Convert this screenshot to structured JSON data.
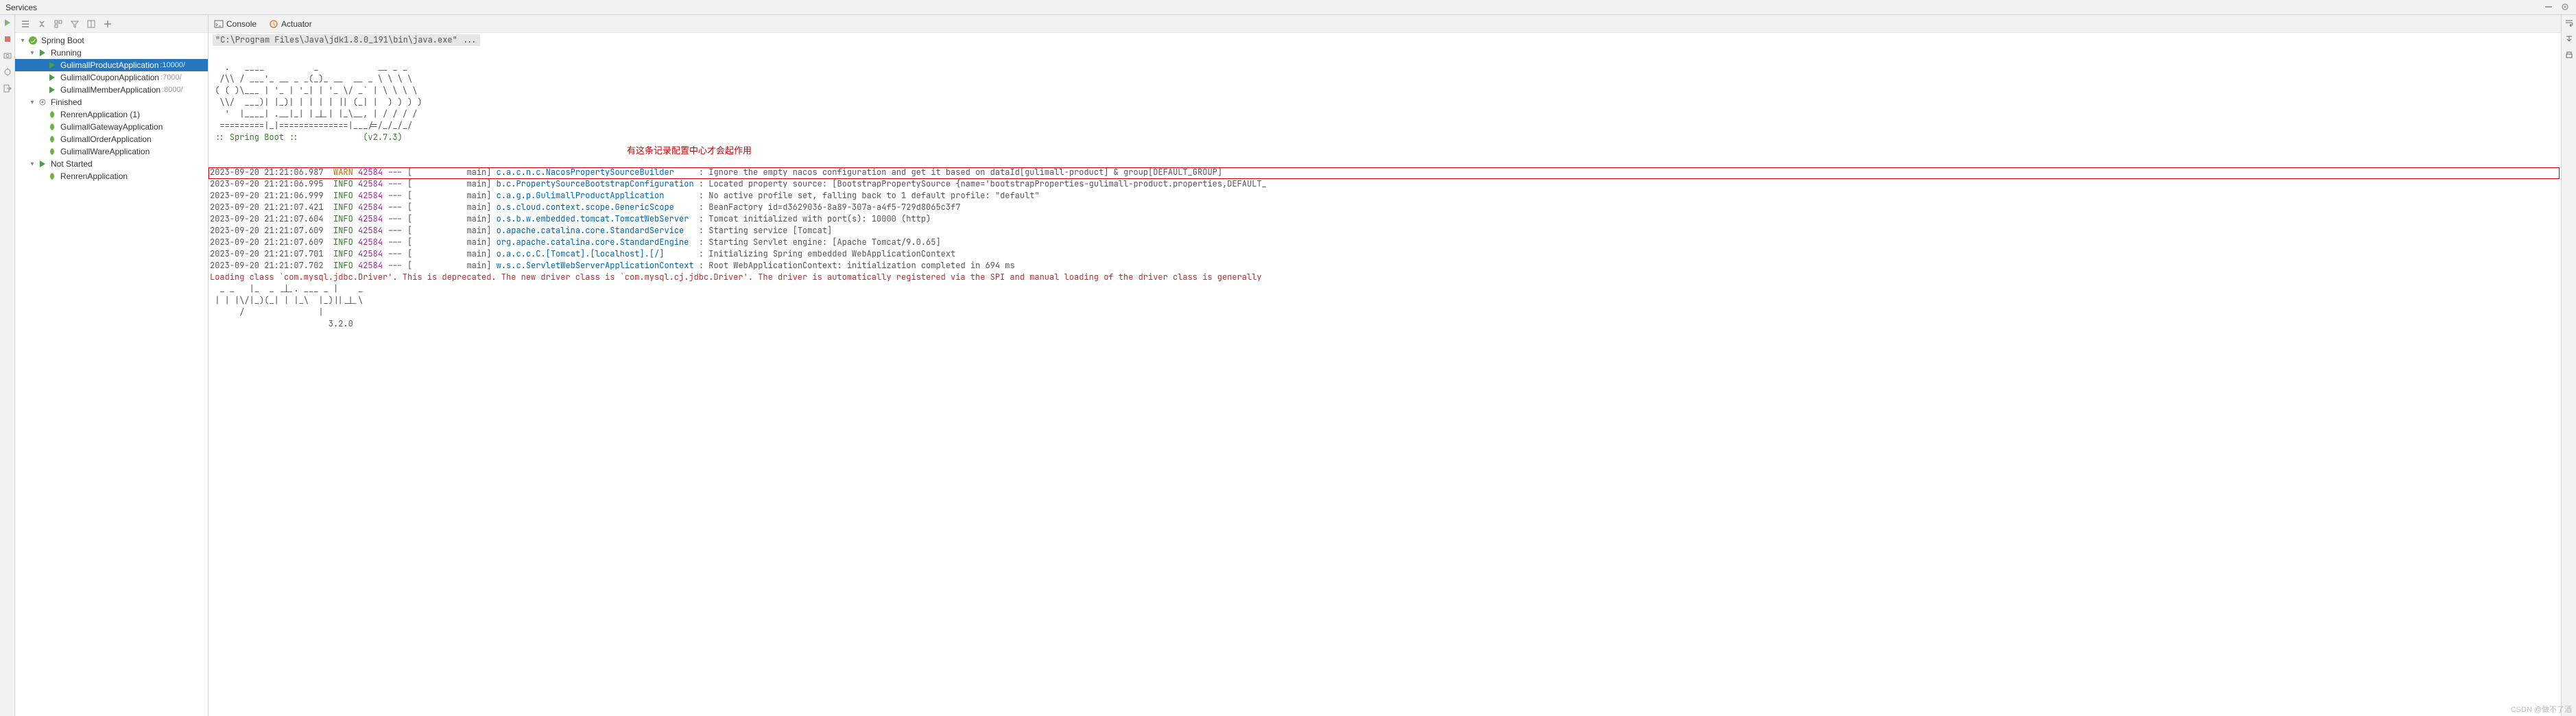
{
  "title": "Services",
  "tree": {
    "root": "Spring Boot",
    "running_label": "Running",
    "finished_label": "Finished",
    "not_started_label": "Not Started",
    "running": [
      {
        "name": "GulimallProductApplication",
        "port": ":10000/"
      },
      {
        "name": "GulimallCouponApplication",
        "port": ":7000/"
      },
      {
        "name": "GulimallMemberApplication",
        "port": ":8000/"
      }
    ],
    "finished": [
      {
        "name": "RenrenApplication (1)"
      },
      {
        "name": "GulimallGatewayApplication"
      },
      {
        "name": "GulimallOrderApplication"
      },
      {
        "name": "GulimallWareApplication"
      }
    ],
    "not_started": [
      {
        "name": "RenrenApplication"
      }
    ]
  },
  "tabs": {
    "console": "Console",
    "actuator": "Actuator"
  },
  "cmd": "\"C:\\Program Files\\Java\\jdk1.8.0_191\\bin\\java.exe\" ...",
  "ascii": [
    "   .   ____          _            __ _ _",
    "  /\\\\ / ___'_ __ _ _(_)_ __  __ _ \\ \\ \\ \\",
    " ( ( )\\___ | '_ | '_| | '_ \\/ _` | \\ \\ \\ \\",
    "  \\\\/  ___)| |_)| | | | | || (_| |  ) ) ) )",
    "   '  |____| .__|_| |_|_| |_\\__, | / / / /",
    "  =========|_|==============|___/=/_/_/_/"
  ],
  "boot_line": " :: Spring Boot ::             (v2.7.3)",
  "annotation": "有这条记录配置中心才会起作用",
  "logs": [
    {
      "ts": "2023-09-20 21:21:06.987",
      "lvl": "WARN",
      "pid": "42584",
      "thread": "main",
      "logger": "c.a.c.n.c.NacosPropertySourceBuilder     ",
      "msg": "Ignore the empty nacos configuration and get it based on dataId[gulimall-product] & group[DEFAULT_GROUP]"
    },
    {
      "ts": "2023-09-20 21:21:06.995",
      "lvl": "INFO",
      "pid": "42584",
      "thread": "main",
      "logger": "b.c.PropertySourceBootstrapConfiguration ",
      "msg": "Located property source: [BootstrapPropertySource {name='bootstrapProperties-gulimall-product.properties,DEFAULT_"
    },
    {
      "ts": "2023-09-20 21:21:06.999",
      "lvl": "INFO",
      "pid": "42584",
      "thread": "main",
      "logger": "c.a.g.p.GulimallProductApplication       ",
      "msg": "No active profile set, falling back to 1 default profile: \"default\""
    },
    {
      "ts": "2023-09-20 21:21:07.421",
      "lvl": "INFO",
      "pid": "42584",
      "thread": "main",
      "logger": "o.s.cloud.context.scope.GenericScope     ",
      "msg": "BeanFactory id=d3629036-8a89-307a-a4f5-729d8065c3f7"
    },
    {
      "ts": "2023-09-20 21:21:07.604",
      "lvl": "INFO",
      "pid": "42584",
      "thread": "main",
      "logger": "o.s.b.w.embedded.tomcat.TomcatWebServer  ",
      "msg": "Tomcat initialized with port(s): 10000 (http)"
    },
    {
      "ts": "2023-09-20 21:21:07.609",
      "lvl": "INFO",
      "pid": "42584",
      "thread": "main",
      "logger": "o.apache.catalina.core.StandardService   ",
      "msg": "Starting service [Tomcat]"
    },
    {
      "ts": "2023-09-20 21:21:07.609",
      "lvl": "INFO",
      "pid": "42584",
      "thread": "main",
      "logger": "org.apache.catalina.core.StandardEngine  ",
      "msg": "Starting Servlet engine: [Apache Tomcat/9.0.65]"
    },
    {
      "ts": "2023-09-20 21:21:07.701",
      "lvl": "INFO",
      "pid": "42584",
      "thread": "main",
      "logger": "o.a.c.c.C.[Tomcat].[localhost].[/]       ",
      "msg": "Initializing Spring embedded WebApplicationContext"
    },
    {
      "ts": "2023-09-20 21:21:07.702",
      "lvl": "INFO",
      "pid": "42584",
      "thread": "main",
      "logger": "w.s.c.ServletWebServerApplicationContext ",
      "msg": "Root WebApplicationContext: initialization completed in 694 ms"
    }
  ],
  "driver_line": "Loading class `com.mysql.jdbc.Driver'. This is deprecated. The new driver class is `com.mysql.cj.jdbc.Driver'. The driver is automatically registered via the SPI and manual loading of the driver class is generally",
  "ascii2": [
    "  _ _   |_  _ _|_. ___ _ |    _ ",
    " | | |\\/|_)(_| | |_\\  |_)||_|_\\ ",
    "      /               |         ",
    "                        3.2.0 "
  ],
  "watermark": "CSDN @做不了酒"
}
